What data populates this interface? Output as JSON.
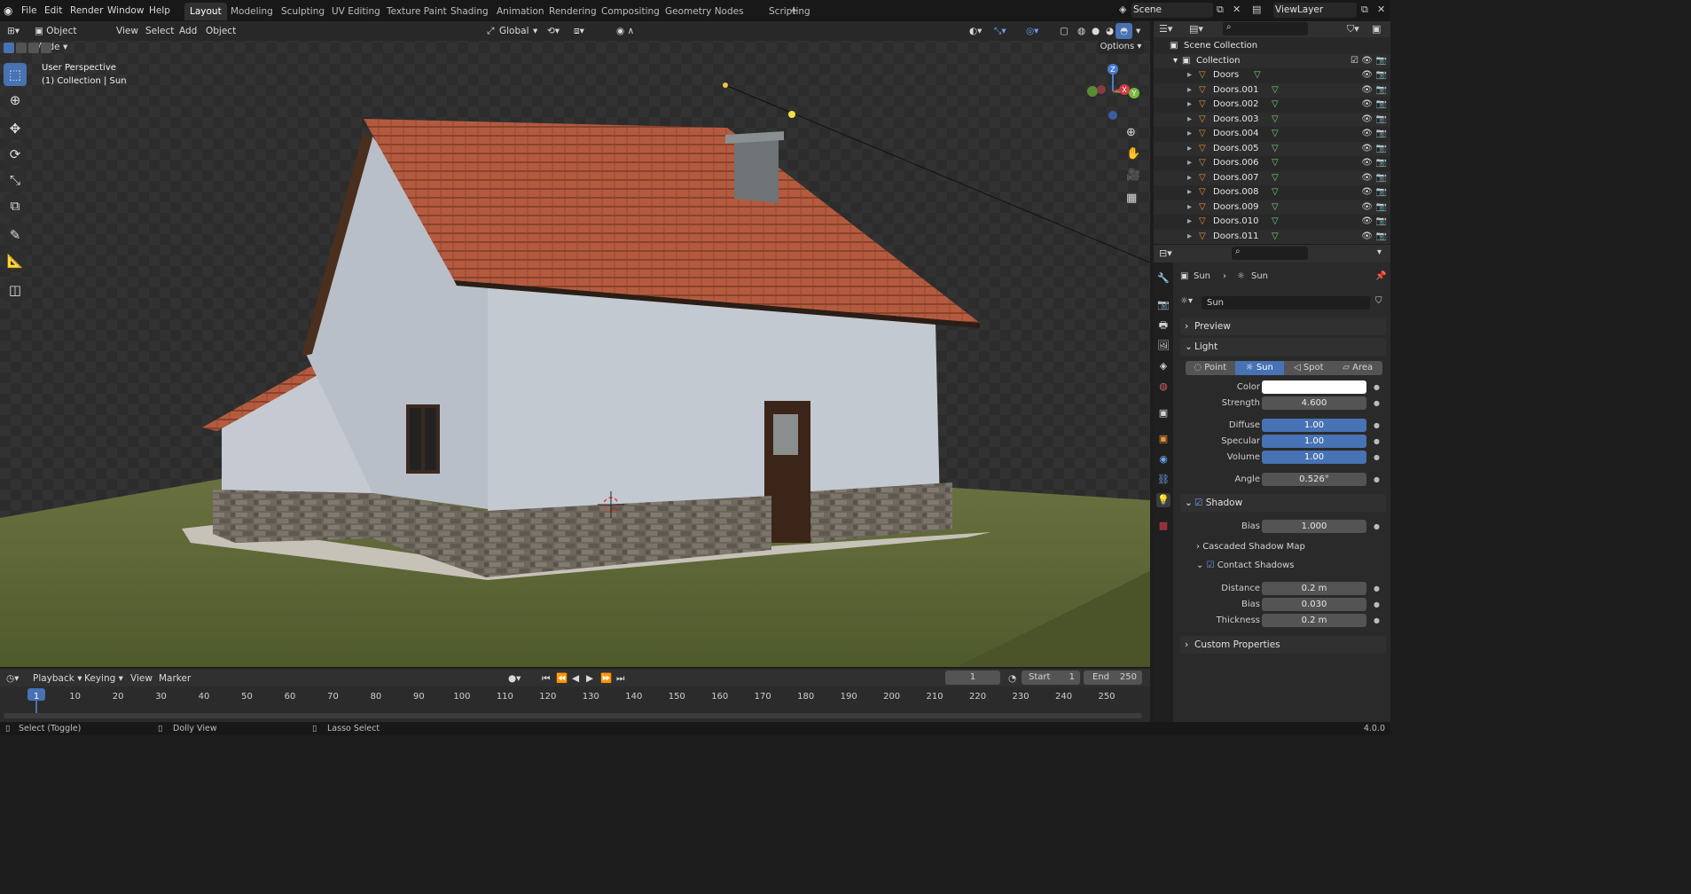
{
  "menus": [
    "File",
    "Edit",
    "Render",
    "Window",
    "Help"
  ],
  "workspaces": [
    "Layout",
    "Modeling",
    "Sculpting",
    "UV Editing",
    "Texture Paint",
    "Shading",
    "Animation",
    "Rendering",
    "Compositing",
    "Geometry Nodes",
    "Scripting"
  ],
  "scene": "Scene",
  "view_layer": "ViewLayer",
  "viewport": {
    "mode": "Object Mode",
    "header_menus": [
      "View",
      "Select",
      "Add",
      "Object"
    ],
    "orientation": "Global",
    "options": "Options",
    "overlay_line1": "User Perspective",
    "overlay_line2": "(1) Collection | Sun"
  },
  "outliner": {
    "scene_collection": "Scene Collection",
    "collection": "Collection",
    "objects": [
      "Doors",
      "Doors.001",
      "Doors.002",
      "Doors.003",
      "Doors.004",
      "Doors.005",
      "Doors.006",
      "Doors.007",
      "Doors.008",
      "Doors.009",
      "Doors.010",
      "Doors.011"
    ]
  },
  "properties": {
    "breadcrumb_object": "Sun",
    "breadcrumb_data": "Sun",
    "data_name": "Sun",
    "panels": {
      "preview": "Preview",
      "light": "Light",
      "shadow": "Shadow",
      "cascaded": "Cascaded Shadow Map",
      "contact": "Contact Shadows",
      "custom": "Custom Properties"
    },
    "light_types": [
      "Point",
      "Sun",
      "Spot",
      "Area"
    ],
    "active_light_type": "Sun",
    "labels": {
      "color": "Color",
      "strength": "Strength",
      "diffuse": "Diffuse",
      "specular": "Specular",
      "volume": "Volume",
      "angle": "Angle",
      "bias": "Bias",
      "distance": "Distance",
      "contact_bias": "Bias",
      "thickness": "Thickness"
    },
    "values": {
      "color": "#ffffff",
      "strength": "4.600",
      "diffuse": "1.00",
      "specular": "1.00",
      "volume": "1.00",
      "angle": "0.526°",
      "shadow_bias": "1.000",
      "distance": "0.2 m",
      "contact_bias": "0.030",
      "thickness": "0.2 m"
    }
  },
  "timeline": {
    "menus": [
      "Playback",
      "Keying",
      "View",
      "Marker"
    ],
    "current_frame": "1",
    "start_label": "Start",
    "start": "1",
    "end_label": "End",
    "end": "250",
    "ticks": [
      "1",
      "10",
      "20",
      "30",
      "40",
      "50",
      "60",
      "70",
      "80",
      "90",
      "100",
      "110",
      "120",
      "130",
      "140",
      "150",
      "160",
      "170",
      "180",
      "190",
      "200",
      "210",
      "220",
      "230",
      "240",
      "250"
    ]
  },
  "statusbar": {
    "select": "Select (Toggle)",
    "dolly": "Dolly View",
    "lasso": "Lasso Select",
    "version": "4.0.0"
  },
  "colors": {
    "accent": "#4772b3",
    "object_icon": "#e8913a",
    "mesh_icon": "#7ad27a",
    "roof": "#b55a3e",
    "wall": "#c9ced4",
    "grass": "#5c6634"
  }
}
